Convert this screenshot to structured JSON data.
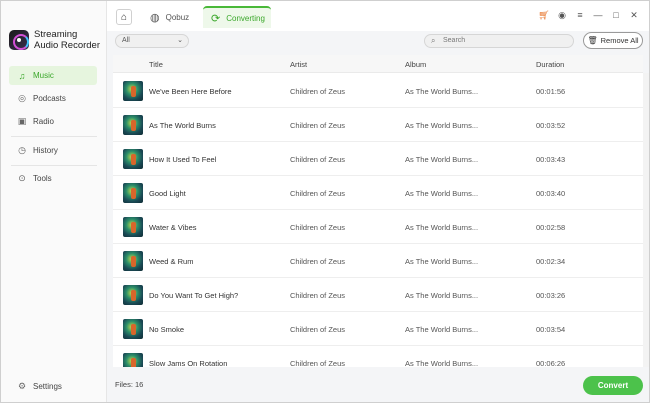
{
  "app": {
    "name_line1": "Streaming",
    "name_line2": "Audio Recorder"
  },
  "sidebar": {
    "items": [
      {
        "label": "Music",
        "icon": "music-note-icon",
        "active": true
      },
      {
        "label": "Podcasts",
        "icon": "podcast-icon",
        "active": false
      },
      {
        "label": "Radio",
        "icon": "radio-icon",
        "active": false
      },
      {
        "label": "History",
        "icon": "history-icon",
        "active": false
      },
      {
        "label": "Tools",
        "icon": "tools-icon",
        "active": false
      }
    ],
    "settings_label": "Settings"
  },
  "tabs": [
    {
      "label": "Qobuz",
      "icon": "globe-icon"
    },
    {
      "label": "Converting",
      "icon": "refresh-icon"
    }
  ],
  "toolbar": {
    "filter_value": "All",
    "search_placeholder": "Search",
    "remove_all_label": "Remove All"
  },
  "table": {
    "columns": [
      "Title",
      "Artist",
      "Album",
      "Duration"
    ],
    "rows": [
      {
        "title": "We've Been Here Before",
        "artist": "Children of Zeus",
        "album": "As The World Burns...",
        "duration": "00:01:56"
      },
      {
        "title": "As The World Burns",
        "artist": "Children of Zeus",
        "album": "As The World Burns...",
        "duration": "00:03:52"
      },
      {
        "title": "How It Used To Feel",
        "artist": "Children of Zeus",
        "album": "As The World Burns...",
        "duration": "00:03:43"
      },
      {
        "title": "Good Light",
        "artist": "Children of Zeus",
        "album": "As The World Burns...",
        "duration": "00:03:40"
      },
      {
        "title": "Water & Vibes",
        "artist": "Children of Zeus",
        "album": "As The World Burns...",
        "duration": "00:02:58"
      },
      {
        "title": "Weed & Rum",
        "artist": "Children of Zeus",
        "album": "As The World Burns...",
        "duration": "00:02:34"
      },
      {
        "title": "Do You Want To Get High?",
        "artist": "Children of Zeus",
        "album": "As The World Burns...",
        "duration": "00:03:26"
      },
      {
        "title": "No Smoke",
        "artist": "Children of Zeus",
        "album": "As The World Burns...",
        "duration": "00:03:54"
      },
      {
        "title": "Slow Jams On Rotation",
        "artist": "Children of Zeus",
        "album": "As The World Burns...",
        "duration": "00:06:26"
      }
    ]
  },
  "footer": {
    "files_label": "Files: 16",
    "convert_label": "Convert"
  },
  "colors": {
    "accent": "#4cc24b",
    "accent_dark": "#3aa72a",
    "cart": "#e8772e"
  }
}
